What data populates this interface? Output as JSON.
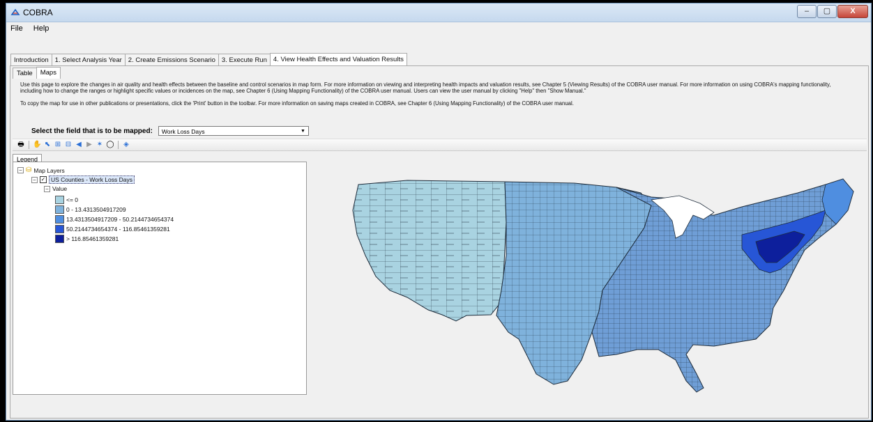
{
  "window": {
    "title": "COBRA",
    "buttons": [
      "–",
      "▢",
      "X"
    ]
  },
  "menu": [
    "File",
    "Help"
  ],
  "tabs": [
    {
      "label": "Introduction",
      "active": false
    },
    {
      "label": "1. Select Analysis Year",
      "active": false
    },
    {
      "label": "2. Create Emissions Scenario",
      "active": false
    },
    {
      "label": "3. Execute Run",
      "active": false
    },
    {
      "label": "4. View Health Effects and Valuation Results",
      "active": true
    }
  ],
  "subtabs": [
    {
      "label": "Table",
      "active": false
    },
    {
      "label": "Maps",
      "active": true
    }
  ],
  "info": {
    "p1": "Use this page to explore the changes in air quality and health effects between the baseline and control scenarios in map form.  For more information on viewing and interpreting health impacts and valuation results, see Chapter 5 (Viewing Results) of the COBRA user manual.  For more information on using COBRA's mapping functionality, including how to change the ranges or highlight specific values or incidences on the map, see Chapter 6 (Using Mapping Functionality) of the COBRA user manual.  Users can view the user manual by clicking \"Help\" then \"Show Manual.\"",
    "p2": "To copy the map for use in other publications or presentations, click the 'Print' button in the toolbar.  For more information on saving maps created in COBRA, see Chapter 6 (Using Mapping Functionality) of the COBRA user manual."
  },
  "field": {
    "label": "Select the field that is to be mapped:",
    "selected": "Work Loss Days"
  },
  "toolbar_icons": [
    "print-icon",
    "pan-icon",
    "select-icon",
    "zoom-in-icon",
    "zoom-out-icon",
    "back-icon",
    "forward-icon",
    "identify-icon",
    "full-extent-icon",
    "layer-icon"
  ],
  "legend": {
    "tab_label": "Legend",
    "root": "Map Layers",
    "layer": "US Counties - Work Loss Days",
    "field": "Value",
    "classes": [
      {
        "label": "<= 0",
        "color": "#a9d3e1"
      },
      {
        "label": "0 - 13.4313504917209",
        "color": "#7fb2dc"
      },
      {
        "label": "13.4313504917209 - 50.2144734654374",
        "color": "#4f8ee0"
      },
      {
        "label": "50.2144734654374 - 116.85461359281",
        "color": "#2756d6"
      },
      {
        "label": "> 116.85461359281",
        "color": "#0d1f9c"
      }
    ]
  },
  "map": {
    "west_color": "#a9d3e1",
    "east_color": "#6f9ed6",
    "mid_color": "#4f8ee0",
    "high_color": "#2756d6",
    "max_color": "#0d1f9c",
    "border_color": "#1d2b3a"
  }
}
